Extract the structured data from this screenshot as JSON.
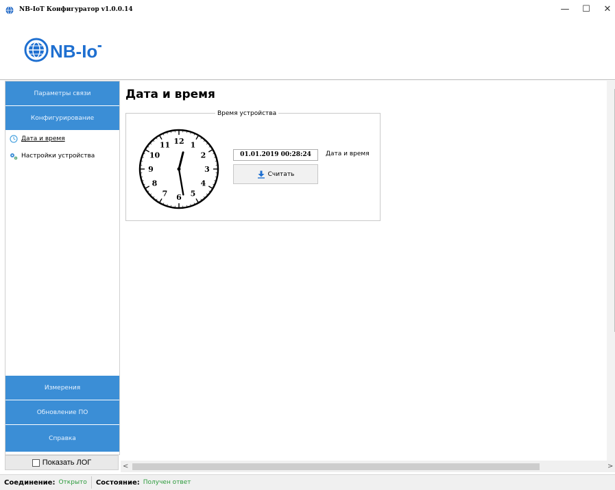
{
  "window": {
    "title": "NB-IoT Конфигуратор v1.0.0.14",
    "minimize_glyph": "—",
    "maximize_glyph": "☐",
    "close_glyph": "✕"
  },
  "logo": {
    "text": "NB-IoT"
  },
  "sidebar": {
    "top_buttons": [
      {
        "label": "Параметры связи"
      },
      {
        "label": "Конфигурирование"
      }
    ],
    "tree": [
      {
        "label": "Дата и время",
        "icon": "clock-icon",
        "active": true
      },
      {
        "label": "Настройки устройства",
        "icon": "gears-icon",
        "active": false
      }
    ],
    "bottom_buttons": [
      {
        "label": "Измерения"
      },
      {
        "label": "Обновление ПО"
      },
      {
        "label": "Справка"
      }
    ],
    "show_log_label": "Показать ЛОГ"
  },
  "main": {
    "title": "Дата и время",
    "group_caption": "Время устройства",
    "datetime_value": "01.01.2019 00:28:24",
    "datetime_label": "Дата и время",
    "read_button_label": "Считать",
    "clock": {
      "hour": 0,
      "minute": 28,
      "second": 24,
      "numbers": [
        "12",
        "1",
        "2",
        "3",
        "4",
        "5",
        "6",
        "7",
        "8",
        "9",
        "10",
        "11"
      ]
    }
  },
  "status": {
    "connection_label": "Соединение:",
    "connection_value": "Открыто",
    "state_label": "Состояние:",
    "state_value": "Получен ответ"
  },
  "colors": {
    "nav_button": "#3b8ed6",
    "status_value": "#2a9a3a",
    "accent": "#1e6fd0"
  }
}
